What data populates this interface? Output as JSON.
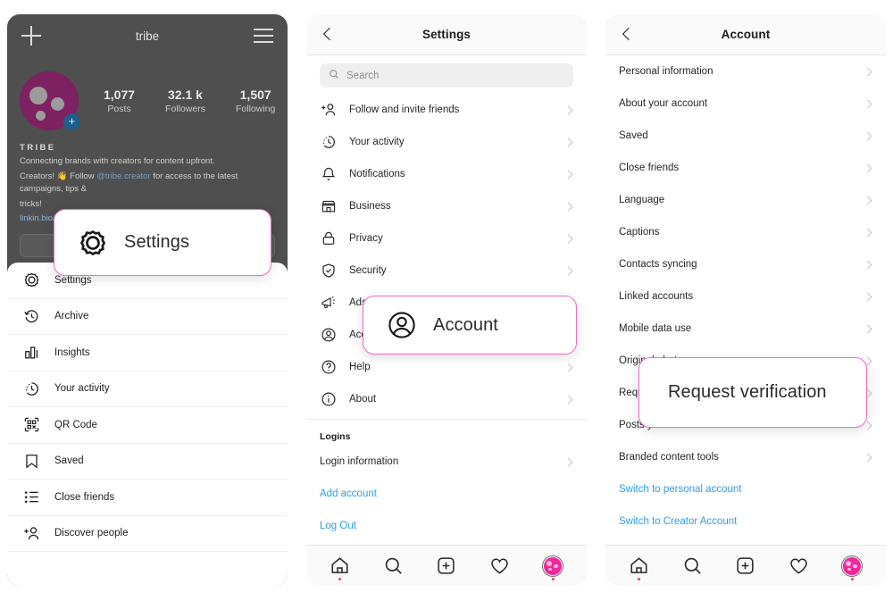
{
  "phone1": {
    "name": "profile-screen",
    "topbar": {
      "add_icon": "plus-icon",
      "username": "tribe",
      "menu_icon": "hamburger-icon"
    },
    "profile": {
      "avatar_color": "#7d2160",
      "add_badge": "+",
      "stats": [
        {
          "value": "1,077",
          "label": "Posts"
        },
        {
          "value": "32.1 k",
          "label": "Followers"
        },
        {
          "value": "1,507",
          "label": "Following"
        }
      ],
      "display_name": "TRIBE",
      "bio_line1": "Connecting brands with creators for content upfront.",
      "bio_line2_pre": "Creators! 👋 Follow ",
      "bio_handle": "@tribe.creator",
      "bio_line2_post": " for access to the latest campaigns, tips &",
      "bio_line3": "tricks!",
      "website": "linkin.bio/tribe"
    },
    "menu": [
      {
        "label": "Settings",
        "icon": "settings-gear-icon"
      },
      {
        "label": "Archive",
        "icon": "archive-clock-icon"
      },
      {
        "label": "Insights",
        "icon": "insights-bar-chart-icon"
      },
      {
        "label": "Your activity",
        "icon": "activity-clock-icon"
      },
      {
        "label": "QR Code",
        "icon": "qr-code-icon"
      },
      {
        "label": "Saved",
        "icon": "bookmark-icon"
      },
      {
        "label": "Close friends",
        "icon": "close-friends-list-icon"
      },
      {
        "label": "Discover people",
        "icon": "add-person-icon"
      }
    ]
  },
  "phone2": {
    "name": "settings-screen",
    "header": {
      "back_icon": "back-chevron-icon",
      "title": "Settings"
    },
    "search": {
      "placeholder": "Search",
      "icon": "search-icon"
    },
    "items": [
      {
        "label": "Follow and invite friends",
        "icon": "add-person-icon"
      },
      {
        "label": "Your activity",
        "icon": "activity-clock-icon"
      },
      {
        "label": "Notifications",
        "icon": "bell-icon"
      },
      {
        "label": "Business",
        "icon": "storefront-icon"
      },
      {
        "label": "Privacy",
        "icon": "lock-icon"
      },
      {
        "label": "Security",
        "icon": "shield-check-icon"
      },
      {
        "label": "Ads",
        "icon": "megaphone-icon"
      },
      {
        "label": "Account",
        "icon": "account-circle-icon"
      },
      {
        "label": "Help",
        "icon": "help-question-icon"
      },
      {
        "label": "About",
        "icon": "info-icon"
      }
    ],
    "logins_section": {
      "title": "Logins",
      "items": [
        {
          "label": "Login information",
          "style": "default"
        },
        {
          "label": "Add account",
          "style": "link"
        },
        {
          "label": "Log Out",
          "style": "link"
        }
      ]
    }
  },
  "phone3": {
    "name": "account-screen",
    "header": {
      "back_icon": "back-chevron-icon",
      "title": "Account"
    },
    "items": [
      {
        "label": "Personal information",
        "style": "default"
      },
      {
        "label": "About your account",
        "style": "default"
      },
      {
        "label": "Saved",
        "style": "default"
      },
      {
        "label": "Close friends",
        "style": "default"
      },
      {
        "label": "Language",
        "style": "default"
      },
      {
        "label": "Captions",
        "style": "default"
      },
      {
        "label": "Contacts syncing",
        "style": "default"
      },
      {
        "label": "Linked accounts",
        "style": "default"
      },
      {
        "label": "Mobile data use",
        "style": "default"
      },
      {
        "label": "Original photos",
        "style": "default"
      },
      {
        "label": "Request verification",
        "style": "default"
      },
      {
        "label": "Posts you've liked",
        "style": "default"
      },
      {
        "label": "Branded content tools",
        "style": "default"
      },
      {
        "label": "Switch to personal account",
        "style": "link"
      },
      {
        "label": "Switch to Creator Account",
        "style": "link"
      }
    ]
  },
  "tabbar": {
    "items": [
      {
        "name": "home-tab",
        "icon": "home-icon",
        "badge": true
      },
      {
        "name": "search-tab",
        "icon": "search-icon",
        "badge": false
      },
      {
        "name": "create-tab",
        "icon": "plus-square-icon",
        "badge": false
      },
      {
        "name": "activity-tab",
        "icon": "heart-icon",
        "badge": false
      },
      {
        "name": "profile-tab",
        "icon": "profile-avatar-icon",
        "badge": true
      }
    ]
  },
  "callouts": {
    "settings": {
      "label": "Settings",
      "icon": "settings-gear-icon",
      "border_color": "#f06bc8"
    },
    "account": {
      "label": "Account",
      "icon": "account-circle-icon",
      "border_color": "#f06bc8"
    },
    "verify": {
      "label": "Request verification",
      "border_color": "#f06bc8"
    }
  },
  "colors": {
    "accent_pink": "#f06bc8",
    "link_blue": "#2b9ced",
    "avatar_magenta": "#7d2160",
    "tab_avatar_pink": "#f2259b",
    "overlay_gray": "#4f4f4f"
  }
}
